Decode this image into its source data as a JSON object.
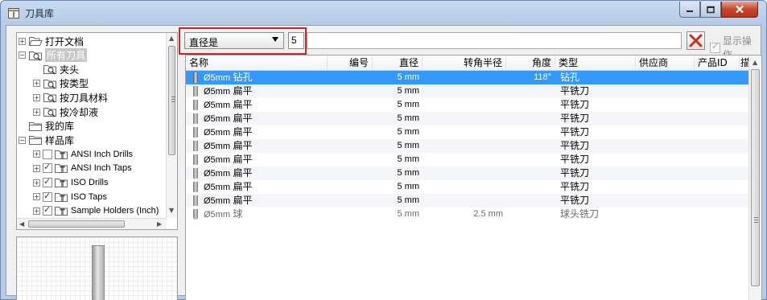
{
  "window": {
    "title": "刀具库"
  },
  "tree": {
    "items": [
      {
        "label": "打开文档",
        "level": 0,
        "expander": "+",
        "icon": "folder-open-icon",
        "checkbox": null,
        "selected": false
      },
      {
        "label": "所有刀具",
        "level": 0,
        "expander": "−",
        "icon": "tool-search-icon",
        "checkbox": null,
        "selected": true
      },
      {
        "label": "夹头",
        "level": 1,
        "expander": "",
        "icon": "tool-search-icon",
        "checkbox": null,
        "selected": false
      },
      {
        "label": "按类型",
        "level": 1,
        "expander": "+",
        "icon": "tool-search-icon",
        "checkbox": null,
        "selected": false
      },
      {
        "label": "按刀具材料",
        "level": 1,
        "expander": "+",
        "icon": "tool-search-icon",
        "checkbox": null,
        "selected": false
      },
      {
        "label": "按冷却液",
        "level": 1,
        "expander": "+",
        "icon": "tool-search-icon",
        "checkbox": null,
        "selected": false
      },
      {
        "label": "我的库",
        "level": 0,
        "expander": "",
        "icon": "folder-icon",
        "checkbox": null,
        "selected": false
      },
      {
        "label": "样品库",
        "level": 0,
        "expander": "−",
        "icon": "folder-icon",
        "checkbox": null,
        "selected": false
      },
      {
        "label": "ANSI Inch Drills",
        "level": 1,
        "expander": "+",
        "icon": "library-icon",
        "checkbox": false,
        "selected": false
      },
      {
        "label": "ANSI Inch Taps",
        "level": 1,
        "expander": "+",
        "icon": "library-icon",
        "checkbox": true,
        "selected": false
      },
      {
        "label": "ISO Drills",
        "level": 1,
        "expander": "+",
        "icon": "library-icon",
        "checkbox": true,
        "selected": false
      },
      {
        "label": "ISO Taps",
        "level": 1,
        "expander": "+",
        "icon": "library-icon",
        "checkbox": true,
        "selected": false
      },
      {
        "label": "Sample Holders (Inch)",
        "level": 1,
        "expander": "+",
        "icon": "library-icon",
        "checkbox": true,
        "selected": false
      }
    ]
  },
  "filter": {
    "field": "直径是",
    "value": "5",
    "search_value": "",
    "show_operations_label": "显示操作",
    "show_operations_checked": true
  },
  "table": {
    "columns": [
      {
        "key": "name",
        "label": "名称"
      },
      {
        "key": "number",
        "label": "编号"
      },
      {
        "key": "diameter",
        "label": "直径"
      },
      {
        "key": "corner_radius",
        "label": "转角半径"
      },
      {
        "key": "angle",
        "label": "角度"
      },
      {
        "key": "type",
        "label": "类型"
      },
      {
        "key": "vendor",
        "label": "供应商"
      },
      {
        "key": "product_id",
        "label": "产品ID"
      },
      {
        "key": "more",
        "label": "描"
      }
    ],
    "rows": [
      {
        "dim": "Ø5mm",
        "name": "钻孔",
        "diameter": "5 mm",
        "corner_radius": "",
        "angle": "118°",
        "type": "钻孔",
        "icon": "drill-icon",
        "selected": true,
        "gray": false
      },
      {
        "dim": "Ø5mm",
        "name": "扁平",
        "diameter": "5 mm",
        "corner_radius": "",
        "angle": "",
        "type": "平铣刀",
        "icon": "flat-mill-icon",
        "selected": false,
        "gray": false
      },
      {
        "dim": "Ø5mm",
        "name": "扁平",
        "diameter": "5 mm",
        "corner_radius": "",
        "angle": "",
        "type": "平铣刀",
        "icon": "flat-mill-icon",
        "selected": false,
        "gray": false
      },
      {
        "dim": "Ø5mm",
        "name": "扁平",
        "diameter": "5 mm",
        "corner_radius": "",
        "angle": "",
        "type": "平铣刀",
        "icon": "flat-mill-icon",
        "selected": false,
        "gray": false
      },
      {
        "dim": "Ø5mm",
        "name": "扁平",
        "diameter": "5 mm",
        "corner_radius": "",
        "angle": "",
        "type": "平铣刀",
        "icon": "flat-mill-icon",
        "selected": false,
        "gray": false
      },
      {
        "dim": "Ø5mm",
        "name": "扁平",
        "diameter": "5 mm",
        "corner_radius": "",
        "angle": "",
        "type": "平铣刀",
        "icon": "flat-mill-icon",
        "selected": false,
        "gray": false
      },
      {
        "dim": "Ø5mm",
        "name": "扁平",
        "diameter": "5 mm",
        "corner_radius": "",
        "angle": "",
        "type": "平铣刀",
        "icon": "flat-mill-icon",
        "selected": false,
        "gray": false
      },
      {
        "dim": "Ø5mm",
        "name": "扁平",
        "diameter": "5 mm",
        "corner_radius": "",
        "angle": "",
        "type": "平铣刀",
        "icon": "flat-mill-icon",
        "selected": false,
        "gray": false
      },
      {
        "dim": "Ø5mm",
        "name": "扁平",
        "diameter": "5 mm",
        "corner_radius": "",
        "angle": "",
        "type": "平铣刀",
        "icon": "flat-mill-icon",
        "selected": false,
        "gray": false
      },
      {
        "dim": "Ø5mm",
        "name": "扁平",
        "diameter": "5 mm",
        "corner_radius": "",
        "angle": "",
        "type": "平铣刀",
        "icon": "flat-mill-icon",
        "selected": false,
        "gray": false
      },
      {
        "dim": "Ø5mm",
        "name": "球",
        "diameter": "5 mm",
        "corner_radius": "2.5 mm",
        "angle": "",
        "type": "球头铣刀",
        "icon": "ball-mill-icon",
        "selected": false,
        "gray": true
      }
    ]
  },
  "colors": {
    "selection": "#3399ff",
    "highlight_border": "#c9252b",
    "clear_icon": "#d0301b"
  }
}
